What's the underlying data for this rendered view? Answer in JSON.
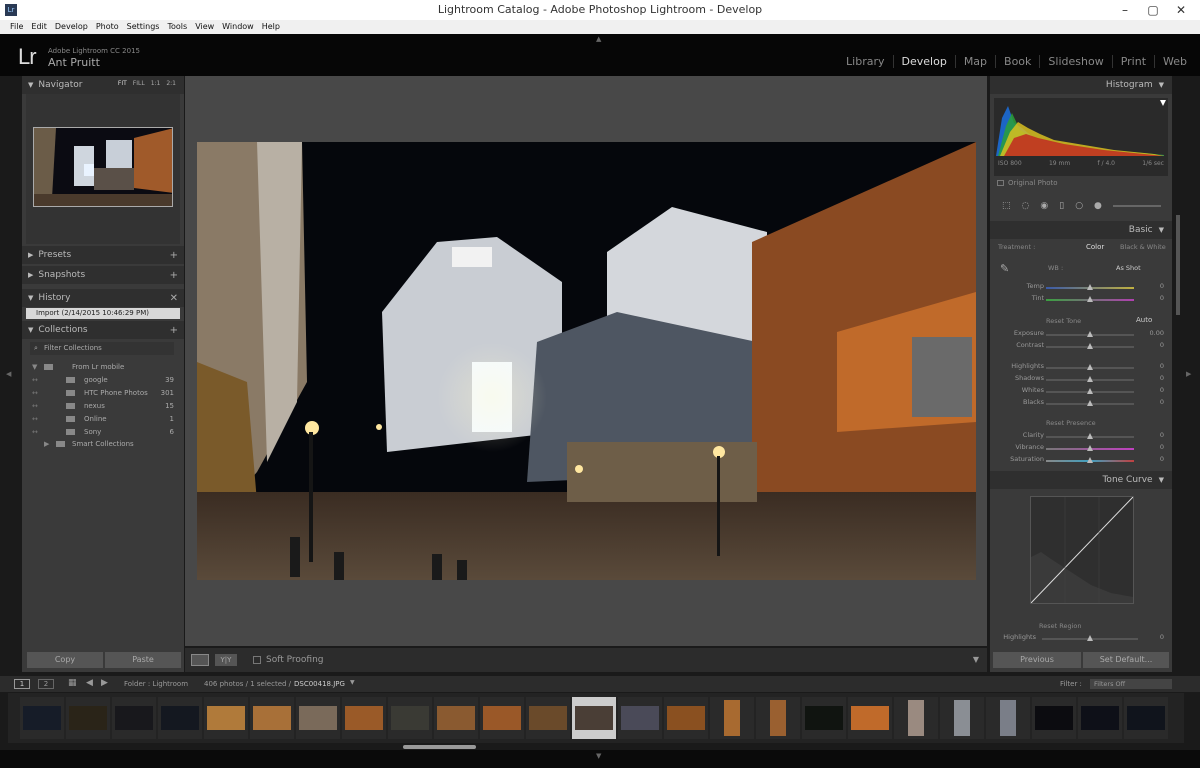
{
  "window": {
    "title": "Lightroom Catalog - Adobe Photoshop Lightroom - Develop"
  },
  "menu": [
    "File",
    "Edit",
    "Develop",
    "Photo",
    "Settings",
    "Tools",
    "View",
    "Window",
    "Help"
  ],
  "identity": {
    "logo": "Lr",
    "product": "Adobe Lightroom CC 2015",
    "user": "Ant Pruitt"
  },
  "modules": [
    "Library",
    "Develop",
    "Map",
    "Book",
    "Slideshow",
    "Print",
    "Web"
  ],
  "active_module": "Develop",
  "left": {
    "navigator": {
      "title": "Navigator",
      "opts": [
        "FIT",
        "FILL",
        "1:1",
        "2:1"
      ]
    },
    "presets": "Presets",
    "snapshots": "Snapshots",
    "history": {
      "title": "History",
      "item": "Import (2/14/2015 10:46:29 PM)"
    },
    "collections": {
      "title": "Collections",
      "filter": "Filter Collections",
      "set": "From Lr mobile",
      "items": [
        {
          "name": "google",
          "count": "39"
        },
        {
          "name": "HTC Phone Photos",
          "count": "301"
        },
        {
          "name": "nexus",
          "count": "15"
        },
        {
          "name": "Online",
          "count": "1"
        },
        {
          "name": "Sony",
          "count": "6"
        }
      ],
      "smart": "Smart Collections"
    },
    "copy": "Copy",
    "paste": "Paste"
  },
  "toolbar": {
    "soft_proofing": "Soft Proofing",
    "yy": "Y|Y"
  },
  "right": {
    "histogram": {
      "title": "Histogram",
      "iso": "ISO 800",
      "focal": "19 mm",
      "aperture": "f / 4.0",
      "shutter": "1/6 sec",
      "original": "Original Photo"
    },
    "basic": {
      "title": "Basic",
      "treatment": "Treatment :",
      "color": "Color",
      "bw": "Black & White",
      "wb": "WB :",
      "wb_value": "As Shot",
      "temp": {
        "label": "Temp",
        "value": "0"
      },
      "tint": {
        "label": "Tint",
        "value": "0"
      },
      "reset_tone": "Reset Tone",
      "auto": "Auto",
      "tone": [
        {
          "label": "Exposure",
          "value": "0.00"
        },
        {
          "label": "Contrast",
          "value": "0"
        },
        {
          "label": "Highlights",
          "value": "0"
        },
        {
          "label": "Shadows",
          "value": "0"
        },
        {
          "label": "Whites",
          "value": "0"
        },
        {
          "label": "Blacks",
          "value": "0"
        }
      ],
      "reset_presence": "Reset Presence",
      "presence": [
        {
          "label": "Clarity",
          "value": "0"
        },
        {
          "label": "Vibrance",
          "value": "0"
        },
        {
          "label": "Saturation",
          "value": "0"
        }
      ]
    },
    "tone_curve": {
      "title": "Tone Curve",
      "reset_region": "Reset Region",
      "highlights": "Highlights",
      "highlights_value": "0"
    },
    "previous": "Previous",
    "set_default": "Set Default..."
  },
  "filmbar": {
    "folder": "Folder : Lightroom",
    "count": "406 photos / 1 selected /",
    "file": "DSC00418.JPG",
    "filter": "Filter :",
    "filter_value": "Filters Off",
    "page1": "1",
    "page2": "2"
  }
}
